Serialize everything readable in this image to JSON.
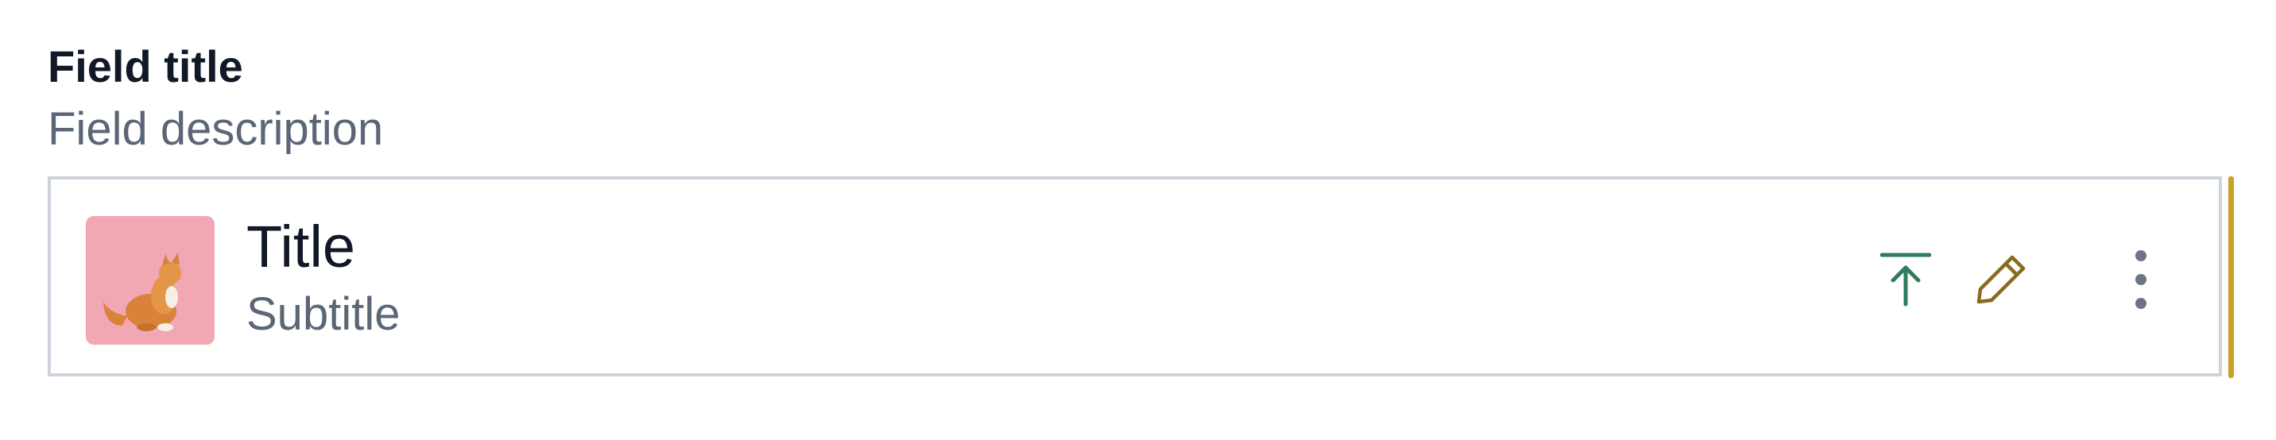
{
  "field": {
    "title": "Field title",
    "description": "Field description"
  },
  "item": {
    "title": "Title",
    "subtitle": "Subtitle",
    "thumbnail": "cat-photo"
  },
  "actions": {
    "publish_icon": "arrow-up-to-line-icon",
    "edit_icon": "pencil-icon",
    "menu_icon": "more-vertical-icon"
  },
  "colors": {
    "publish": "#2f7d5c",
    "edit": "#8a6a1f",
    "menu": "#6b7585",
    "change_indicator": "#c9a227",
    "border": "#cdd3da",
    "thumbnail_bg": "#f2a7b4"
  }
}
